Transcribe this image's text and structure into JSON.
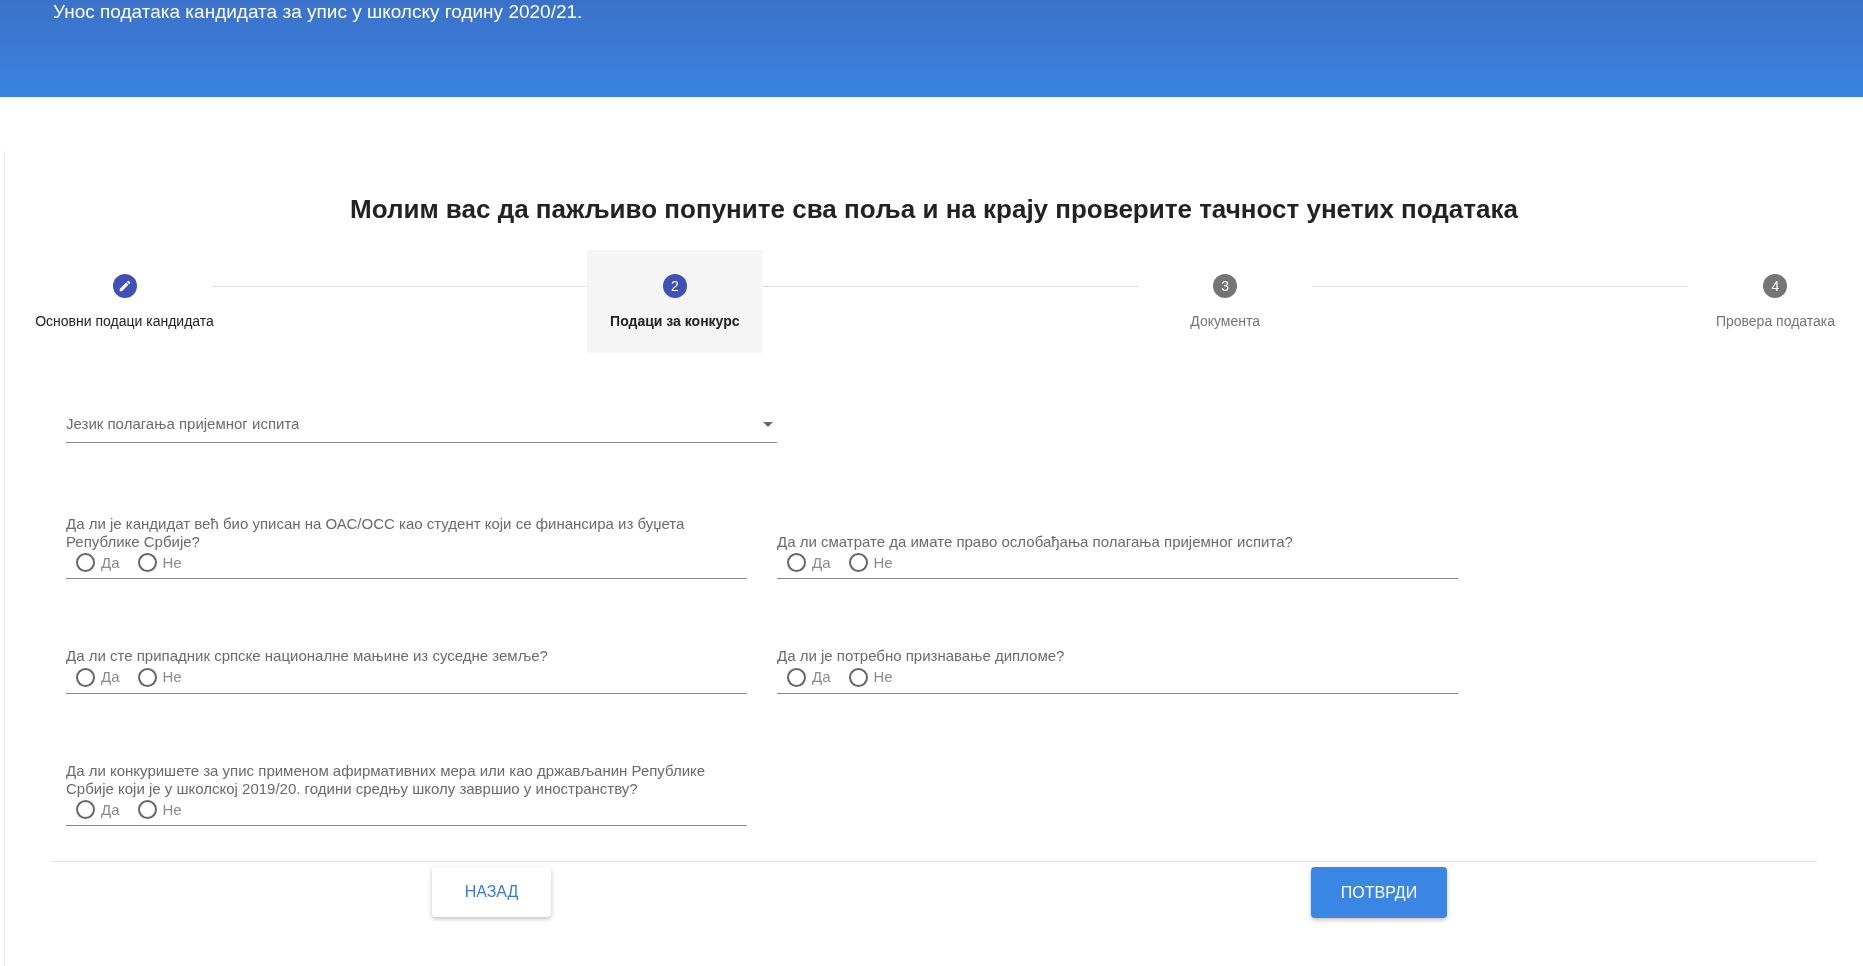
{
  "header": {
    "title": "Унос података кандидата за упис у школску годину 2020/21."
  },
  "heading": "Молим вас да пажљиво попуните сва поља и на крају проверите тачност унетих података",
  "steps": [
    {
      "label": "Основни подаци кандидата",
      "edited": true,
      "selected": false
    },
    {
      "number": "2",
      "label": "Подаци за конкурс",
      "edited": false,
      "selected": true
    },
    {
      "number": "3",
      "label": "Документа",
      "edited": false,
      "selected": false
    },
    {
      "number": "4",
      "label": "Провера података",
      "edited": false,
      "selected": false
    }
  ],
  "language_select": {
    "label": "Језик полагања пријемног испита"
  },
  "questions": [
    {
      "text": "Да ли је кандидат већ био уписан на ОАС/ОСС као студент који се финансира из буџета Републике Србије?",
      "options": [
        {
          "label": "Да",
          "selected": false
        },
        {
          "label": "Не",
          "selected": false
        }
      ]
    },
    {
      "text": "Да ли сматрате да имате право ослобађања полагања пријемног испита?",
      "options": [
        {
          "label": "Да",
          "selected": false
        },
        {
          "label": "Не",
          "selected": false
        }
      ]
    },
    {
      "text": "Да ли сте припадник српске националне мањине из суседне земље?",
      "options": [
        {
          "label": "Да",
          "selected": false
        },
        {
          "label": "Не",
          "selected": false
        }
      ]
    },
    {
      "text": "Да ли је потребно признавање дипломе?",
      "options": [
        {
          "label": "Да",
          "selected": false
        },
        {
          "label": "Не",
          "selected": false
        }
      ]
    },
    {
      "text": "Да ли конкуришете за упис применом афирмативних мера или као држављанин Републике Србије који је у школској 2019/20. години средњу школу завршио у иностранству?",
      "options": [
        {
          "label": "Да",
          "selected": false
        },
        {
          "label": "Не",
          "selected": false
        }
      ]
    }
  ],
  "buttons": {
    "back": "НАЗАД",
    "confirm": "ПОТВРДИ"
  }
}
